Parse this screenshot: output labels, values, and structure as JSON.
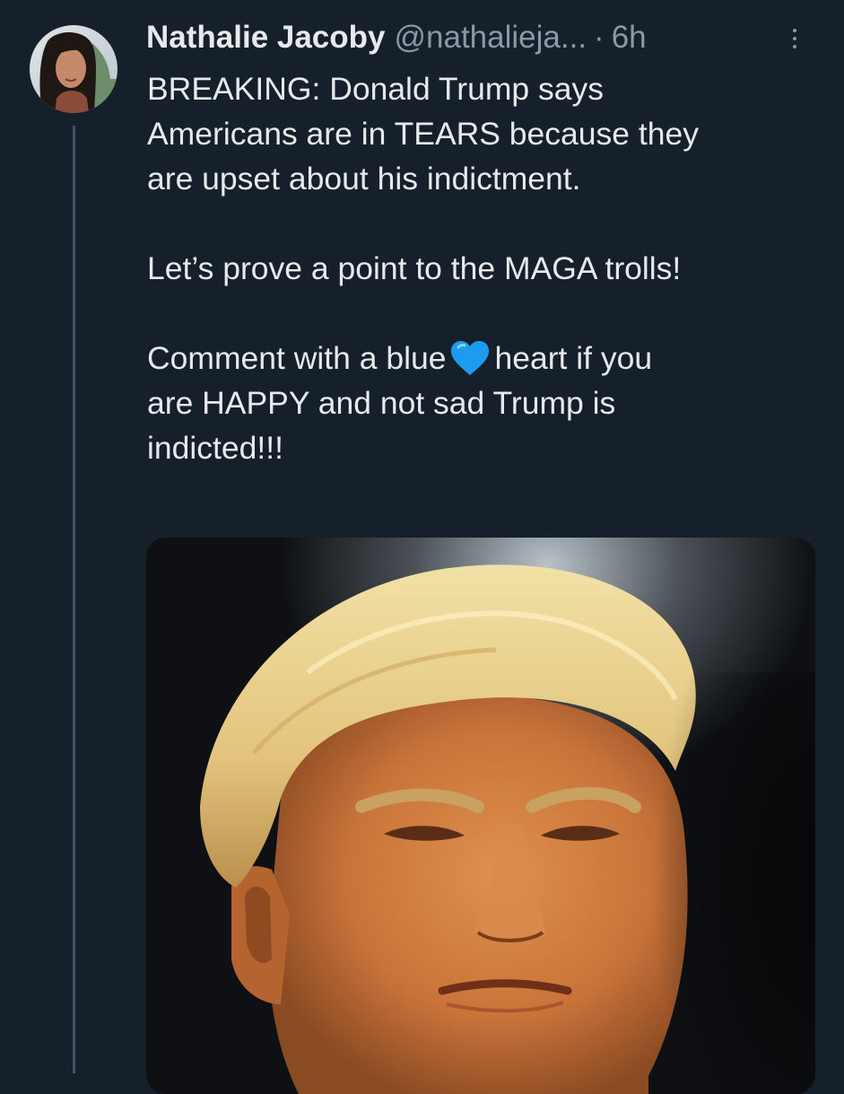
{
  "tweet": {
    "author": {
      "display_name": "Nathalie Jacoby",
      "handle": "@nathalieja...",
      "separator": "·",
      "time": "6h"
    },
    "text": {
      "line1": "BREAKING: Donald Trump says",
      "line2": "Americans are in TEARS because they",
      "line3": "are upset about his indictment.",
      "line4": "Let’s prove a point to the MAGA trolls!",
      "line5_before": "Comment with a blue",
      "line5_after": "heart if you",
      "line6": "are HAPPY and not sad Trump is",
      "line7": "indicted!!!"
    },
    "emoji": "blue-heart-icon",
    "media": "photo-of-donald-trump"
  },
  "colors": {
    "background": "#15202b",
    "text_primary": "#e7e9ea",
    "text_secondary": "#8b98a5",
    "thread_line": "#42536a",
    "heart": "#1d9bf0"
  }
}
